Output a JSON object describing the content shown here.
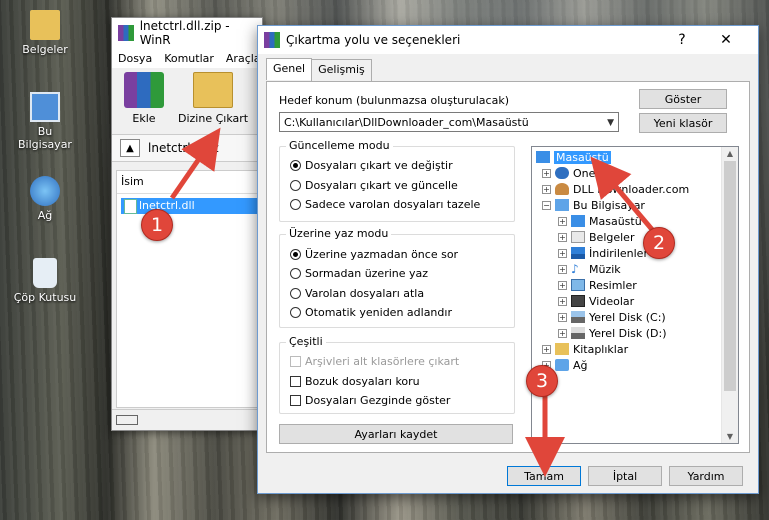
{
  "desktop": {
    "icons": [
      {
        "label": "Belgeler"
      },
      {
        "label": "Bu Bilgisayar"
      },
      {
        "label": "Ağ"
      },
      {
        "label": "Çöp Kutusu"
      }
    ]
  },
  "winrar": {
    "title": "lnetctrl.dll.zip - WinR",
    "menu": [
      "Dosya",
      "Komutlar",
      "Araçla"
    ],
    "tools": {
      "add": "Ekle",
      "extract": "Dizine Çıkart"
    },
    "address": "lnetctrl.dll.z",
    "column_name": "İsim",
    "file_row": "lnetctrl.dll"
  },
  "dialog": {
    "title": "Çıkartma yolu ve seçenekleri",
    "help_btn": "?",
    "close_btn": "✕",
    "tabs": [
      "Genel",
      "Gelişmiş"
    ],
    "target_label": "Hedef konum (bulunmazsa oluşturulacak)",
    "target_value": "C:\\Kullanıcılar\\DllDownloader_com\\Masaüstü",
    "show_btn": "Göster",
    "new_folder_btn": "Yeni klasör",
    "update_mode": {
      "title": "Güncelleme modu",
      "options": [
        "Dosyaları çıkart ve değiştir",
        "Dosyaları çıkart ve güncelle",
        "Sadece varolan dosyaları tazele"
      ]
    },
    "overwrite_mode": {
      "title": "Üzerine yaz modu",
      "options": [
        "Üzerine yazmadan önce sor",
        "Sormadan üzerine yaz",
        "Varolan dosyaları atla",
        "Otomatik yeniden adlandır"
      ]
    },
    "misc": {
      "title": "Çeşitli",
      "options": [
        "Arşivleri alt klasörlere çıkart",
        "Bozuk dosyaları koru",
        "Dosyaları Gezginde göster"
      ]
    },
    "save_btn": "Ayarları kaydet",
    "tree": [
      {
        "label": "Masaüstü"
      },
      {
        "label": "OneDrive"
      },
      {
        "label": "DLL Downloader.com"
      },
      {
        "label": "Bu Bilgisayar"
      },
      {
        "label": "Masaüstü"
      },
      {
        "label": "Belgeler"
      },
      {
        "label": "İndirilenler"
      },
      {
        "label": "Müzik"
      },
      {
        "label": "Resimler"
      },
      {
        "label": "Videolar"
      },
      {
        "label": "Yerel Disk (C:)"
      },
      {
        "label": "Yerel Disk (D:)"
      },
      {
        "label": "Kitaplıklar"
      },
      {
        "label": "Ağ"
      }
    ],
    "ok_btn": "Tamam",
    "cancel_btn": "İptal",
    "help2_btn": "Yardım"
  },
  "markers": [
    "1",
    "2",
    "3"
  ],
  "colors": {
    "marker": "#e0463a",
    "selection": "#3399ff"
  }
}
